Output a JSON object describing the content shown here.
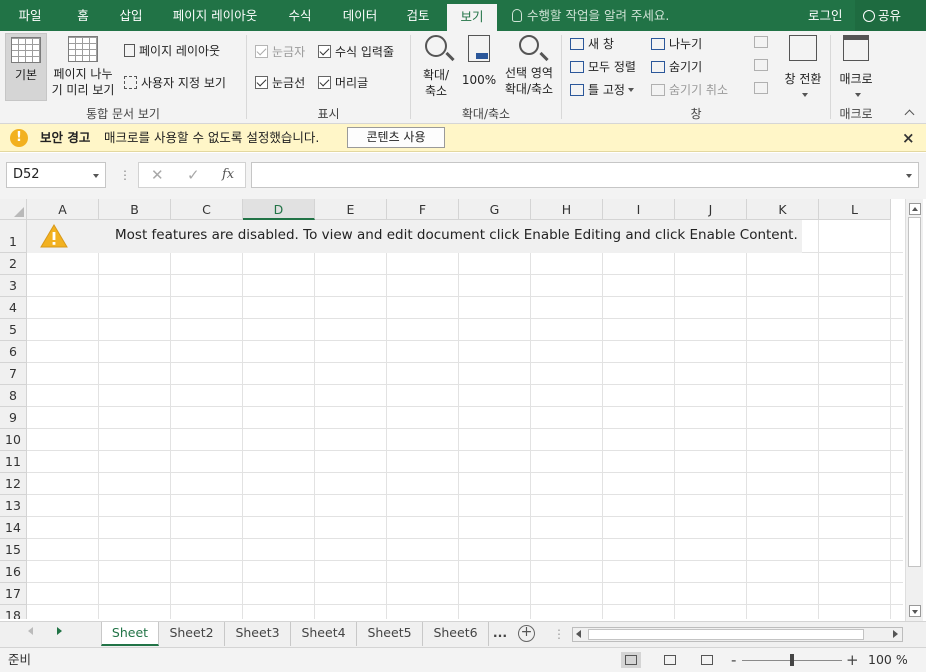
{
  "ribbon_tabs": [
    "파일",
    "홈",
    "삽입",
    "페이지 레이아웃",
    "수식",
    "데이터",
    "검토",
    "보기"
  ],
  "active_tab": "보기",
  "tell_me_placeholder": "수행할 작업을 알려 주세요.",
  "login_label": "로그인",
  "share_label": "공유",
  "ribbon": {
    "workbook_views": {
      "normal": "기본",
      "page_break_line1": "페이지 나누",
      "page_break_line2": "기 미리 보기",
      "page_layout": "페이지 레이아웃",
      "custom_views": "사용자 지정 보기",
      "group_label": "통합 문서 보기"
    },
    "show": {
      "ruler": "눈금자",
      "formula_bar": "수식 입력줄",
      "gridlines": "눈금선",
      "headings": "머리글",
      "group_label": "표시"
    },
    "zoom": {
      "zoom_line1": "확대/",
      "zoom_line2": "축소",
      "zoom_100": "100%",
      "zoom_sel_line1": "선택 영역",
      "zoom_sel_line2": "확대/축소",
      "group_label": "확대/축소"
    },
    "window": {
      "new_window": "새 창",
      "arrange_all": "모두 정렬",
      "freeze_panes": "틀 고정",
      "split": "나누기",
      "hide": "숨기기",
      "unhide": "숨기기 취소",
      "switch_line1": "창 전환",
      "group_label": "창"
    },
    "macros": {
      "macros_label": "매크로",
      "group_label": "매크로"
    }
  },
  "security_bar": {
    "title": "보안 경고",
    "message": "매크로를 사용할 수 없도록 설정했습니다.",
    "button": "콘텐츠 사용",
    "close": "×"
  },
  "formula_bar": {
    "name_box": "D52",
    "cancel": "✕",
    "enter": "✓",
    "fx": "fx",
    "value": ""
  },
  "columns": [
    "A",
    "B",
    "C",
    "D",
    "E",
    "F",
    "G",
    "H",
    "I",
    "J",
    "K",
    "L"
  ],
  "selected_column": "D",
  "rows": [
    "1",
    "2",
    "3",
    "4",
    "5",
    "6",
    "7",
    "8",
    "9",
    "10",
    "11",
    "12",
    "13",
    "14",
    "15",
    "16",
    "17",
    "18"
  ],
  "notice_text": "Most features are disabled. To view and edit document click Enable Editing and click Enable Content.",
  "sheets": [
    "Sheet",
    "Sheet2",
    "Sheet3",
    "Sheet4",
    "Sheet5",
    "Sheet6"
  ],
  "active_sheet": "Sheet",
  "sheets_more": "...",
  "add_sheet": "+",
  "status": {
    "ready": "준비",
    "zoom_minus": "-",
    "zoom_plus": "+",
    "zoom_percent": "100 %",
    "zoom_level": 100
  },
  "colors": {
    "accent": "#217346",
    "ribbon_bg": "#f3f3f3",
    "message_bar": "#fff6c8",
    "warning": "#f2b120"
  }
}
